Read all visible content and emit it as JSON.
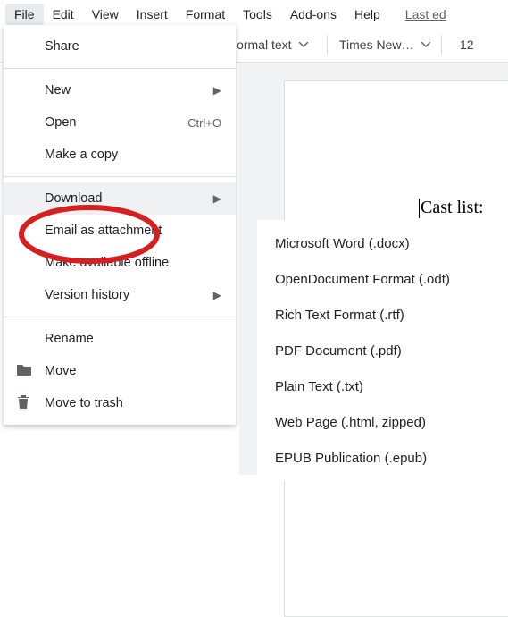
{
  "menubar": {
    "file": "File",
    "edit": "Edit",
    "view": "View",
    "insert": "Insert",
    "format": "Format",
    "tools": "Tools",
    "addons": "Add-ons",
    "help": "Help",
    "last_edit": "Last ed"
  },
  "toolbar": {
    "style": "Normal text",
    "font": "Times New…",
    "font_size": "12"
  },
  "document": {
    "content": "Cast list:"
  },
  "file_menu": {
    "share": "Share",
    "new": "New",
    "open": "Open",
    "open_shortcut": "Ctrl+O",
    "make_copy": "Make a copy",
    "download": "Download",
    "email_attachment": "Email as attachment",
    "make_available_offline": "Make available offline",
    "version_history": "Version history",
    "rename": "Rename",
    "move": "Move",
    "move_to_trash": "Move to trash"
  },
  "download_submenu": {
    "docx": "Microsoft Word (.docx)",
    "odt": "OpenDocument Format (.odt)",
    "rtf": "Rich Text Format (.rtf)",
    "pdf": "PDF Document (.pdf)",
    "txt": "Plain Text (.txt)",
    "html": "Web Page (.html, zipped)",
    "epub": "EPUB Publication (.epub)"
  }
}
